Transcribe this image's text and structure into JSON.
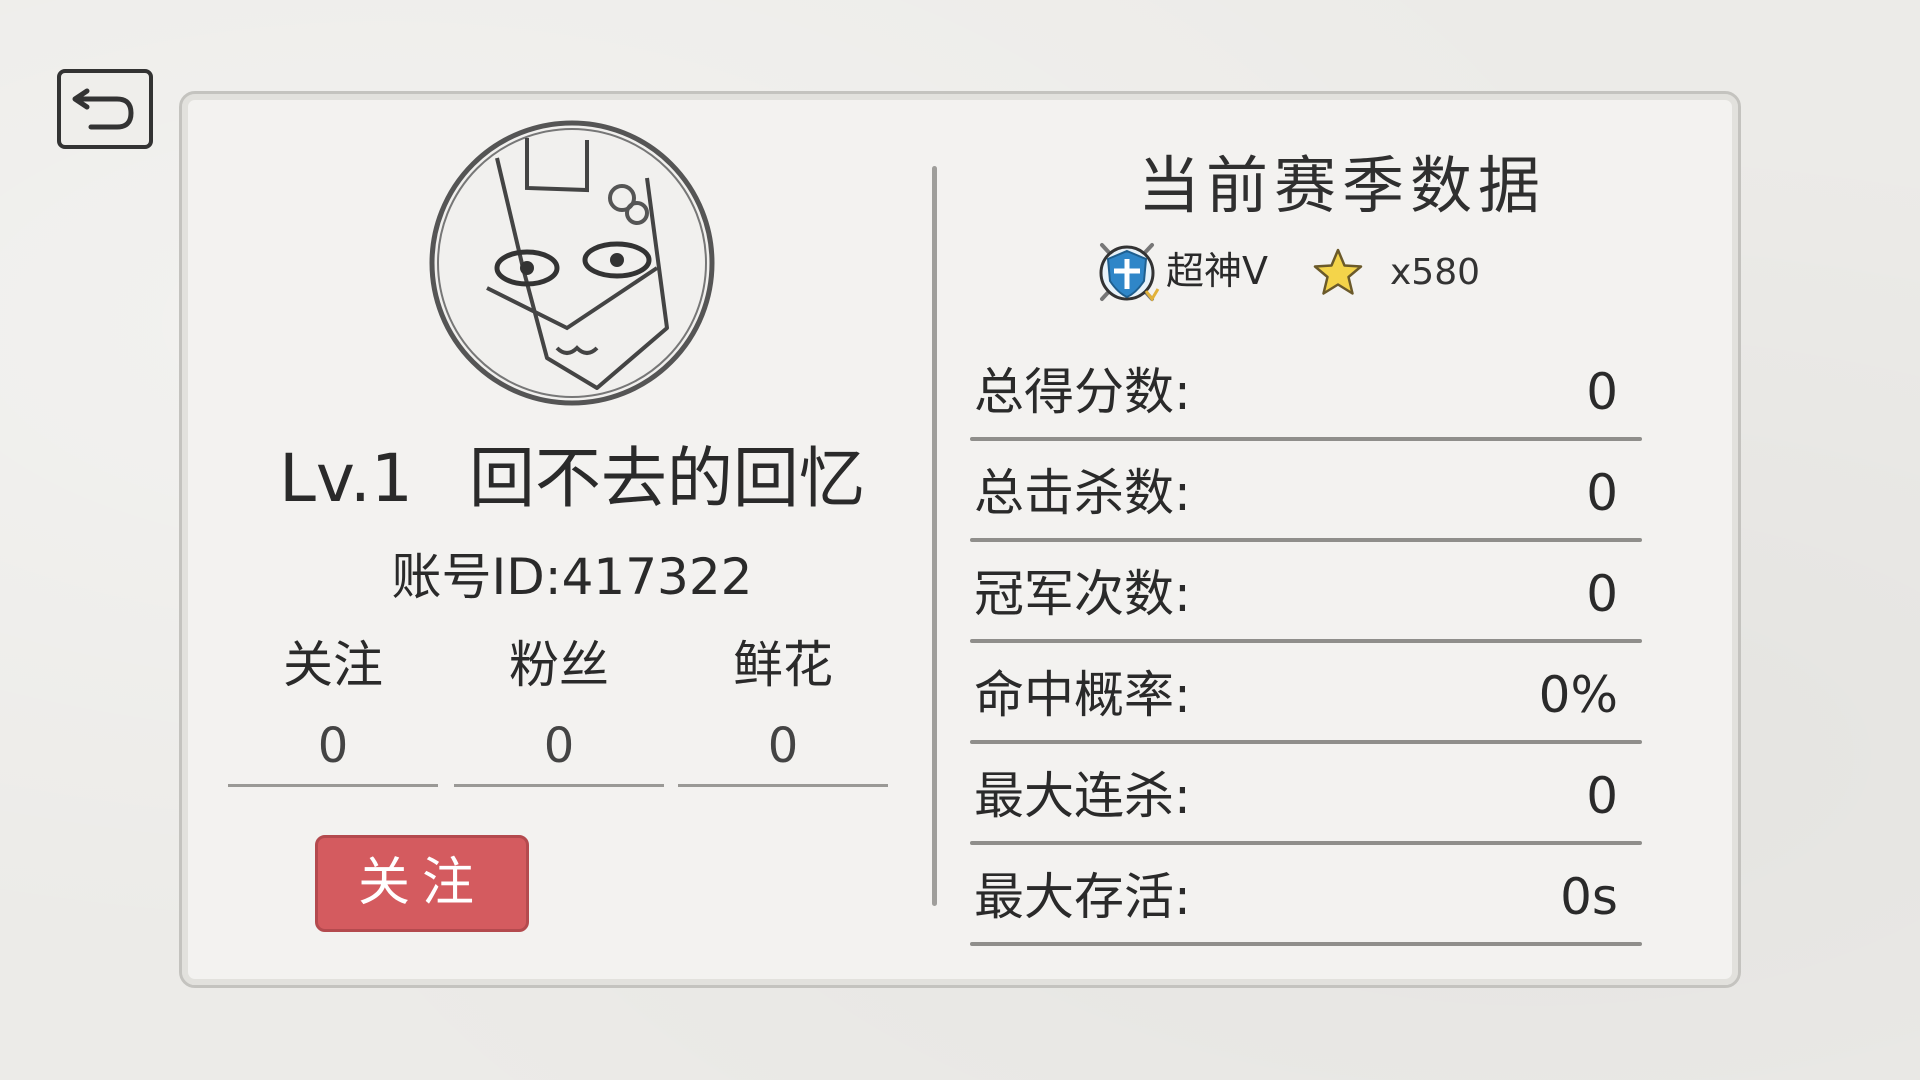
{
  "profile": {
    "level": "Lv.1",
    "name": "回不去的回忆",
    "account_id": "账号ID:417322"
  },
  "social": [
    {
      "label": "关注",
      "value": "0"
    },
    {
      "label": "粉丝",
      "value": "0"
    },
    {
      "label": "鲜花",
      "value": "0"
    }
  ],
  "follow_button": {
    "label": "关注"
  },
  "season": {
    "title": "当前赛季数据",
    "rank_name": "超神V",
    "star_count": "x580"
  },
  "stats": [
    {
      "label": "总得分数:",
      "value": "0"
    },
    {
      "label": "总击杀数:",
      "value": "0"
    },
    {
      "label": "冠军次数:",
      "value": "0"
    },
    {
      "label": "命中概率:",
      "value": "0%"
    },
    {
      "label": "最大连杀:",
      "value": "0"
    },
    {
      "label": "最大存活:",
      "value": "0s"
    }
  ],
  "colors": {
    "follow_button": "#d45b5f",
    "star": "#f4d44a",
    "badge_blue": "#2f86c8"
  },
  "icons": {
    "back": "back-arrow-icon",
    "avatar": "cat-avatar-icon",
    "rank": "rank-shield-icon",
    "star": "star-icon"
  }
}
